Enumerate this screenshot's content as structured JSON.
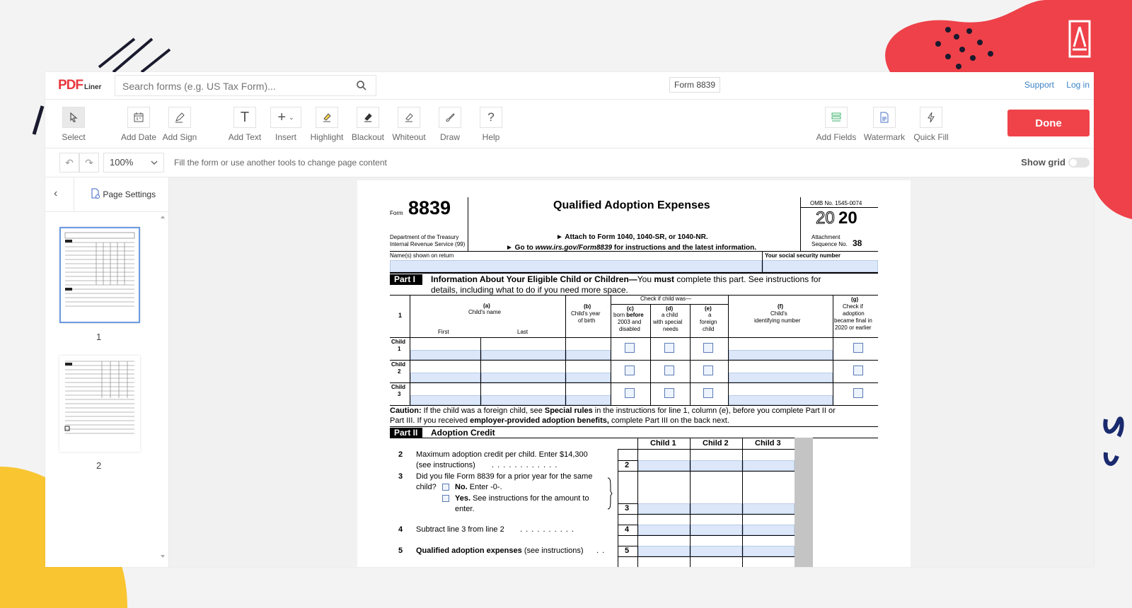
{
  "brand": {
    "name": "PDF",
    "suffix": "Liner"
  },
  "header": {
    "search_placeholder": "Search forms (e.g. US Tax Form)...",
    "form_name": "Form 8839",
    "support": "Support",
    "login": "Log in"
  },
  "toolbar": {
    "select": "Select",
    "add_date": "Add Date",
    "add_sign": "Add Sign",
    "add_text": "Add Text",
    "insert": "Insert",
    "highlight": "Highlight",
    "blackout": "Blackout",
    "whiteout": "Whiteout",
    "draw": "Draw",
    "help": "Help",
    "add_fields": "Add Fields",
    "watermark": "Watermark",
    "quick_fill": "Quick Fill",
    "done": "Done"
  },
  "subbar": {
    "zoom": "100%",
    "hint": "Fill the form or use another tools to change page content",
    "show_grid": "Show grid"
  },
  "sidebar": {
    "page_settings": "Page Settings",
    "pages": [
      "1",
      "2"
    ]
  },
  "form": {
    "form_label": "Form",
    "number": "8839",
    "title": "Qualified Adoption Expenses",
    "dept1": "Department of the Treasury",
    "dept2": "Internal Revenue Service (99)",
    "attach": "► Attach to Form 1040, 1040-SR, or 1040-NR.",
    "goto_pre": "► Go to ",
    "goto_url": "www.irs.gov/Form8839",
    "goto_post": " for instructions and the latest information.",
    "omb": "OMB No. 1545-0074",
    "year_light": "20",
    "year_bold": "20",
    "attachment": "Attachment",
    "sequence": "Sequence No.",
    "seq_no": "38",
    "names_label": "Name(s) shown on return",
    "ssn_label": "Your social security number",
    "part1_tag": "Part I",
    "part1_title": "Information About Your Eligible Child or Children—",
    "part1_you": "You ",
    "part1_must": "must",
    "part1_rest": " complete this part. See instructions for",
    "part1_line2": "details, including what to do if you need more space.",
    "check_if": "Check if child was—",
    "line1": "1",
    "col_a_letter": "(a)",
    "col_a": "Child's name",
    "first": "First",
    "last": "Last",
    "col_b_letter": "(b)",
    "col_b1": "Child's year",
    "col_b2": "of birth",
    "col_c_letter": "(c)",
    "col_c1": "born ",
    "col_c1b": "before",
    "col_c2": "2003 and",
    "col_c3": "disabled",
    "col_d_letter": "(d)",
    "col_d1": "a child",
    "col_d2": "with special",
    "col_d3": "needs",
    "col_e_letter": "(e)",
    "col_e1": "a",
    "col_e2": "foreign",
    "col_e3": "child",
    "col_f_letter": "(f)",
    "col_f1": "Child's",
    "col_f2": "identifying number",
    "col_g_letter": "(g)",
    "col_g1": "Check if",
    "col_g2": "adoption",
    "col_g3": "became final in",
    "col_g4": "2020 or earlier",
    "child_word": "Child",
    "child_nums": [
      "1",
      "2",
      "3"
    ],
    "caution_label": "Caution:",
    "caution1_pre": " If the child was a foreign child, see ",
    "caution1_bold": "Special rules",
    "caution1_post": " in the instructions for line 1, column (e), before you complete Part II or",
    "caution2_pre": "Part III. If you received ",
    "caution2_bold": "employer-provided adoption benefits,",
    "caution2_post": " complete Part III on the back next.",
    "part2_tag": "Part II",
    "part2_title": "Adoption Credit",
    "child_cols": [
      "Child 1",
      "Child 2",
      "Child 3"
    ],
    "line2_num": "2",
    "line2_a": "Maximum adoption credit per child. Enter $14,300",
    "line2_b": "(see instructions)",
    "line2_dots": ". . . . . . . . . . . .",
    "line2_box": "2",
    "line3_num": "3",
    "line3_a": "Did you file Form 8839 for a prior year for the same",
    "line3_b": "child?",
    "line3_no_bold": "No.",
    "line3_no": " Enter -0-.",
    "line3_yes_bold": "Yes.",
    "line3_yes": " See instructions for the amount to",
    "line3_enter": "enter.",
    "line3_box": "3",
    "line4_num": "4",
    "line4_a": "Subtract line 3 from line 2",
    "line4_dots": ". . . . . . . . . .",
    "line4_box": "4",
    "line5_num": "5",
    "line5_a": "Qualified adoption expenses",
    "line5_b": " (see instructions)",
    "line5_dots": ". .",
    "line5_box": "5"
  }
}
